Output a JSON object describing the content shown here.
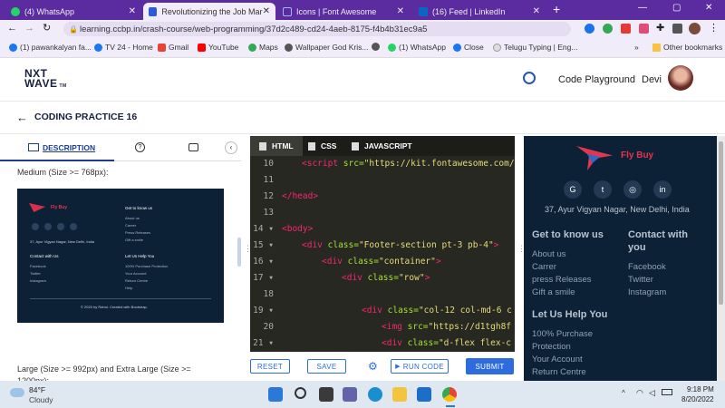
{
  "browser": {
    "tabs": [
      {
        "label": "(4) WhatsApp"
      },
      {
        "label": "Revolutionizing the Job Market |"
      },
      {
        "label": "Icons | Font Awesome"
      },
      {
        "label": "(16) Feed | LinkedIn"
      }
    ],
    "url": "learning.ccbp.in/crash-course/web-programming/37d2c489-cd24-4aeb-8175-f4b4b31ec9a5",
    "bookmarks": [
      "(1) pawankalyan fa...",
      "TV 24 - Home",
      "Gmail",
      "YouTube",
      "Maps",
      "Wallpaper God Kris...",
      "(1) WhatsApp",
      "Close",
      "Telugu Typing | Eng...",
      "Other bookmarks"
    ]
  },
  "header": {
    "logo_line1": "NXT",
    "logo_line2": "WAVE",
    "logo_tm": "TM",
    "code_playground": "Code Playground",
    "user": "Devi"
  },
  "practice": {
    "title": "CODING PRACTICE 16"
  },
  "left": {
    "tab_description": "DESCRIPTION",
    "medium_text": "Medium (Size >= 768px):",
    "large_text": "Large (Size >= 992px) and Extra Large (Size >=",
    "large_text_2": "1200px):",
    "preview": {
      "brand": "Fly Buy",
      "address": "37, Ayur Vigyan Nagar, New Delhi, India",
      "contact": "Contact with Us",
      "contact_items": [
        "Facebook",
        "Twitter",
        "Instagram"
      ],
      "get_to_know": "Get to know us",
      "get_items": [
        "About us",
        "Career",
        "Press Releases",
        "Gift a smile"
      ],
      "help": "Let Us Help You",
      "help_items": [
        "100% Purchase Protection",
        "Your Account",
        "Return Centre",
        "Help"
      ],
      "copyright": "© 2020 by Rahul. Created with Bootstrap."
    }
  },
  "editor": {
    "tabs": [
      "HTML",
      "CSS",
      "JAVASCRIPT"
    ],
    "lines": [
      {
        "n": "10",
        "html": "<span class='tag'>&lt;script</span> <span class='attr'>src=</span><span class='str'>\"https://kit.fontawesome.com/</span>",
        "indent": 22
      },
      {
        "n": "11",
        "html": "",
        "indent": 0
      },
      {
        "n": "12",
        "html": "<span class='tag'>&lt;/head&gt;</span>",
        "indent": 0
      },
      {
        "n": "13",
        "html": "",
        "indent": 0
      },
      {
        "n": "14 ▾",
        "html": "<span class='tag'>&lt;body&gt;</span>",
        "indent": 0
      },
      {
        "n": "15 ▾",
        "html": "<span class='tag'>&lt;div</span> <span class='attr'>class=</span><span class='str'>\"Footer-section pt-3 pb-4\"</span><span class='tag'>&gt;</span>",
        "indent": 22
      },
      {
        "n": "16 ▾",
        "html": "<span class='tag'>&lt;div</span> <span class='attr'>class=</span><span class='str'>\"container\"</span><span class='tag'>&gt;</span>",
        "indent": 44
      },
      {
        "n": "17 ▾",
        "html": "<span class='tag'>&lt;div</span> <span class='attr'>class=</span><span class='str'>\"row\"</span><span class='tag'>&gt;</span>",
        "indent": 66
      },
      {
        "n": "18",
        "html": "",
        "indent": 0
      },
      {
        "n": "19 ▾",
        "html": "<span class='tag'>&lt;div</span> <span class='attr'>class=</span><span class='str'>\"col-12 col-md-6 c</span>",
        "indent": 88
      },
      {
        "n": "20",
        "html": "<span class='tag'>&lt;img</span> <span class='attr'>src=</span><span class='str'>\"https://d1tgh8f</span>",
        "indent": 110
      },
      {
        "n": "21 ▾",
        "html": "<span class='tag'>&lt;div</span> <span class='attr'>class=</span><span class='str'>\"d-flex flex-c</span>",
        "indent": 110
      }
    ],
    "buttons": {
      "reset": "RESET",
      "save": "SAVE",
      "run": "RUN CODE",
      "submit": "SUBMIT"
    }
  },
  "right": {
    "brand": "Fly Buy",
    "address": "37, Ayur Vigyan Nagar, New Delhi, India",
    "get_to_know": "Get to know us",
    "get_items": [
      "About us",
      "Carrer",
      "press Releases",
      "Gift a smile"
    ],
    "contact_line1": "Contact with",
    "contact_line2": "you",
    "contact_items": [
      "Facebook",
      "Twitter",
      "Instagram"
    ],
    "help": "Let Us Help You",
    "help_items": [
      "100% Purchase",
      "Protection",
      "Your Account",
      "Return Centre"
    ]
  },
  "taskbar": {
    "weather_temp": "84°F",
    "weather_desc": "Cloudy",
    "time": "9:18 PM",
    "date": "8/20/2022"
  }
}
